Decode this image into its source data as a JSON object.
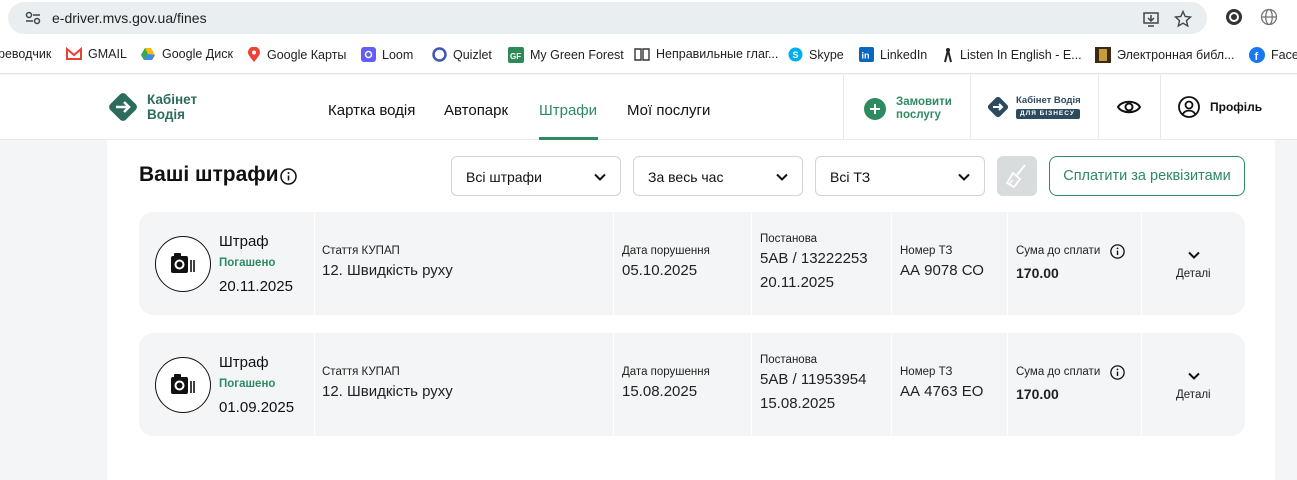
{
  "browser": {
    "url": "e-driver.mvs.gov.ua/fines"
  },
  "bookmarks": [
    {
      "label": "реводчик",
      "icon": "translate-icon",
      "color": "#4285f4"
    },
    {
      "label": "GMAIL",
      "icon": "gmail-icon",
      "color": "#ea4335"
    },
    {
      "label": "Google Диск",
      "icon": "google-drive-icon",
      "color": "#34a853"
    },
    {
      "label": "Google Карты",
      "icon": "google-maps-icon",
      "color": "#ea4335"
    },
    {
      "label": "Loom",
      "icon": "loom-icon",
      "color": "#625df5"
    },
    {
      "label": "Quizlet",
      "icon": "quizlet-icon",
      "color": "#4257b2"
    },
    {
      "label": "My Green Forest",
      "icon": "green-forest-icon",
      "color": "#2e8b57"
    },
    {
      "label": "Неправильные глаг...",
      "icon": "book-icon",
      "color": "#8a6d3b"
    },
    {
      "label": "Skype",
      "icon": "skype-icon",
      "color": "#00aff0"
    },
    {
      "label": "LinkedIn",
      "icon": "linkedin-icon",
      "color": "#0a66c2"
    },
    {
      "label": "Listen In English - E...",
      "icon": "listen-icon",
      "color": "#333333"
    },
    {
      "label": "Электронная библ...",
      "icon": "library-icon",
      "color": "#6b4a1f"
    },
    {
      "label": "Faceb",
      "icon": "facebook-icon",
      "color": "#1877f2"
    }
  ],
  "header": {
    "logo_text": "Кабінет Водія",
    "nav": [
      "Картка водія",
      "Автопарк",
      "Штрафи",
      "Мої послуги"
    ],
    "active_nav": "Штрафи",
    "order_service": "Замовити послугу",
    "biz_logo_top": "Кабінет Водія",
    "biz_logo_bottom": "ДЛЯ БІЗНЕСУ",
    "profile": "Профіль"
  },
  "page": {
    "title": "Ваші штрафи",
    "filters": {
      "status": "Всі штрафи",
      "period": "За весь час",
      "vehicle": "Всі ТЗ"
    },
    "pay_button": "Сплатити за реквізитами"
  },
  "fines": [
    {
      "type": "Штраф",
      "status": "Погашено",
      "date": "20.11.2025",
      "article_label": "Стаття КУПАП",
      "article": "12. Швидкість руху",
      "violation_label": "Дата порушення",
      "violation_date": "05.10.2025",
      "decree_label": "Постанова",
      "decree_number": "5АВ / 13222253",
      "decree_date": "20.11.2025",
      "plate_label": "Номер ТЗ",
      "plate": "АА 9078 СО",
      "amount_label": "Сума до сплати",
      "amount": "170.00",
      "details": "Деталі"
    },
    {
      "type": "Штраф",
      "status": "Погашено",
      "date": "01.09.2025",
      "article_label": "Стаття КУПАП",
      "article": "12. Швидкість руху",
      "violation_label": "Дата порушення",
      "violation_date": "15.08.2025",
      "decree_label": "Постанова",
      "decree_number": "5АВ / 11953954",
      "decree_date": "15.08.2025",
      "plate_label": "Номер ТЗ",
      "plate": "АА 4763 ЕО",
      "amount_label": "Сума до сплати",
      "amount": "170.00",
      "details": "Деталі"
    }
  ],
  "colors": {
    "accent": "#2d8a61",
    "brand": "#2d6b5c"
  }
}
